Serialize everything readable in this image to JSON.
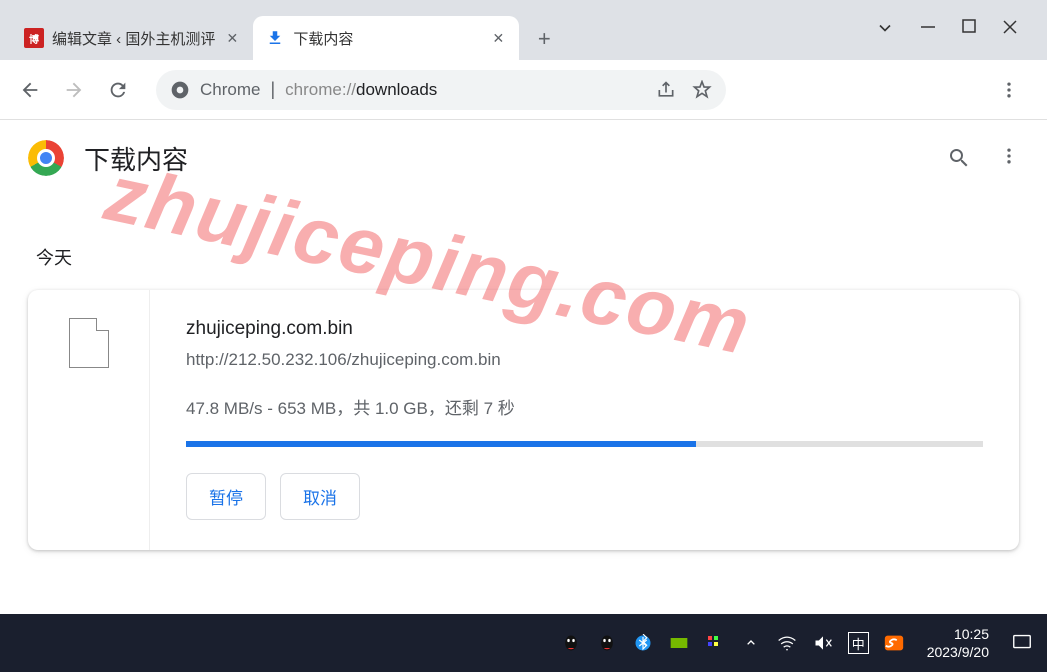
{
  "tabs": [
    {
      "title": "编辑文章 ‹ 国外主机测评",
      "favicon_label": "博"
    },
    {
      "title": "下载内容"
    }
  ],
  "omnibox": {
    "label": "Chrome",
    "url_plain_prefix": "chrome://",
    "url_highlight": "downloads"
  },
  "header": {
    "title": "下载内容"
  },
  "section_label": "今天",
  "download": {
    "filename": "zhujiceping.com.bin",
    "url": "http://212.50.232.106/zhujiceping.com.bin",
    "status": "47.8 MB/s - 653 MB，共 1.0 GB，还剩 7 秒",
    "progress_percent": 64,
    "pause_label": "暂停",
    "cancel_label": "取消"
  },
  "watermark": "zhujiceping.com",
  "taskbar": {
    "time": "10:25",
    "date": "2023/9/20",
    "ime": "中"
  }
}
